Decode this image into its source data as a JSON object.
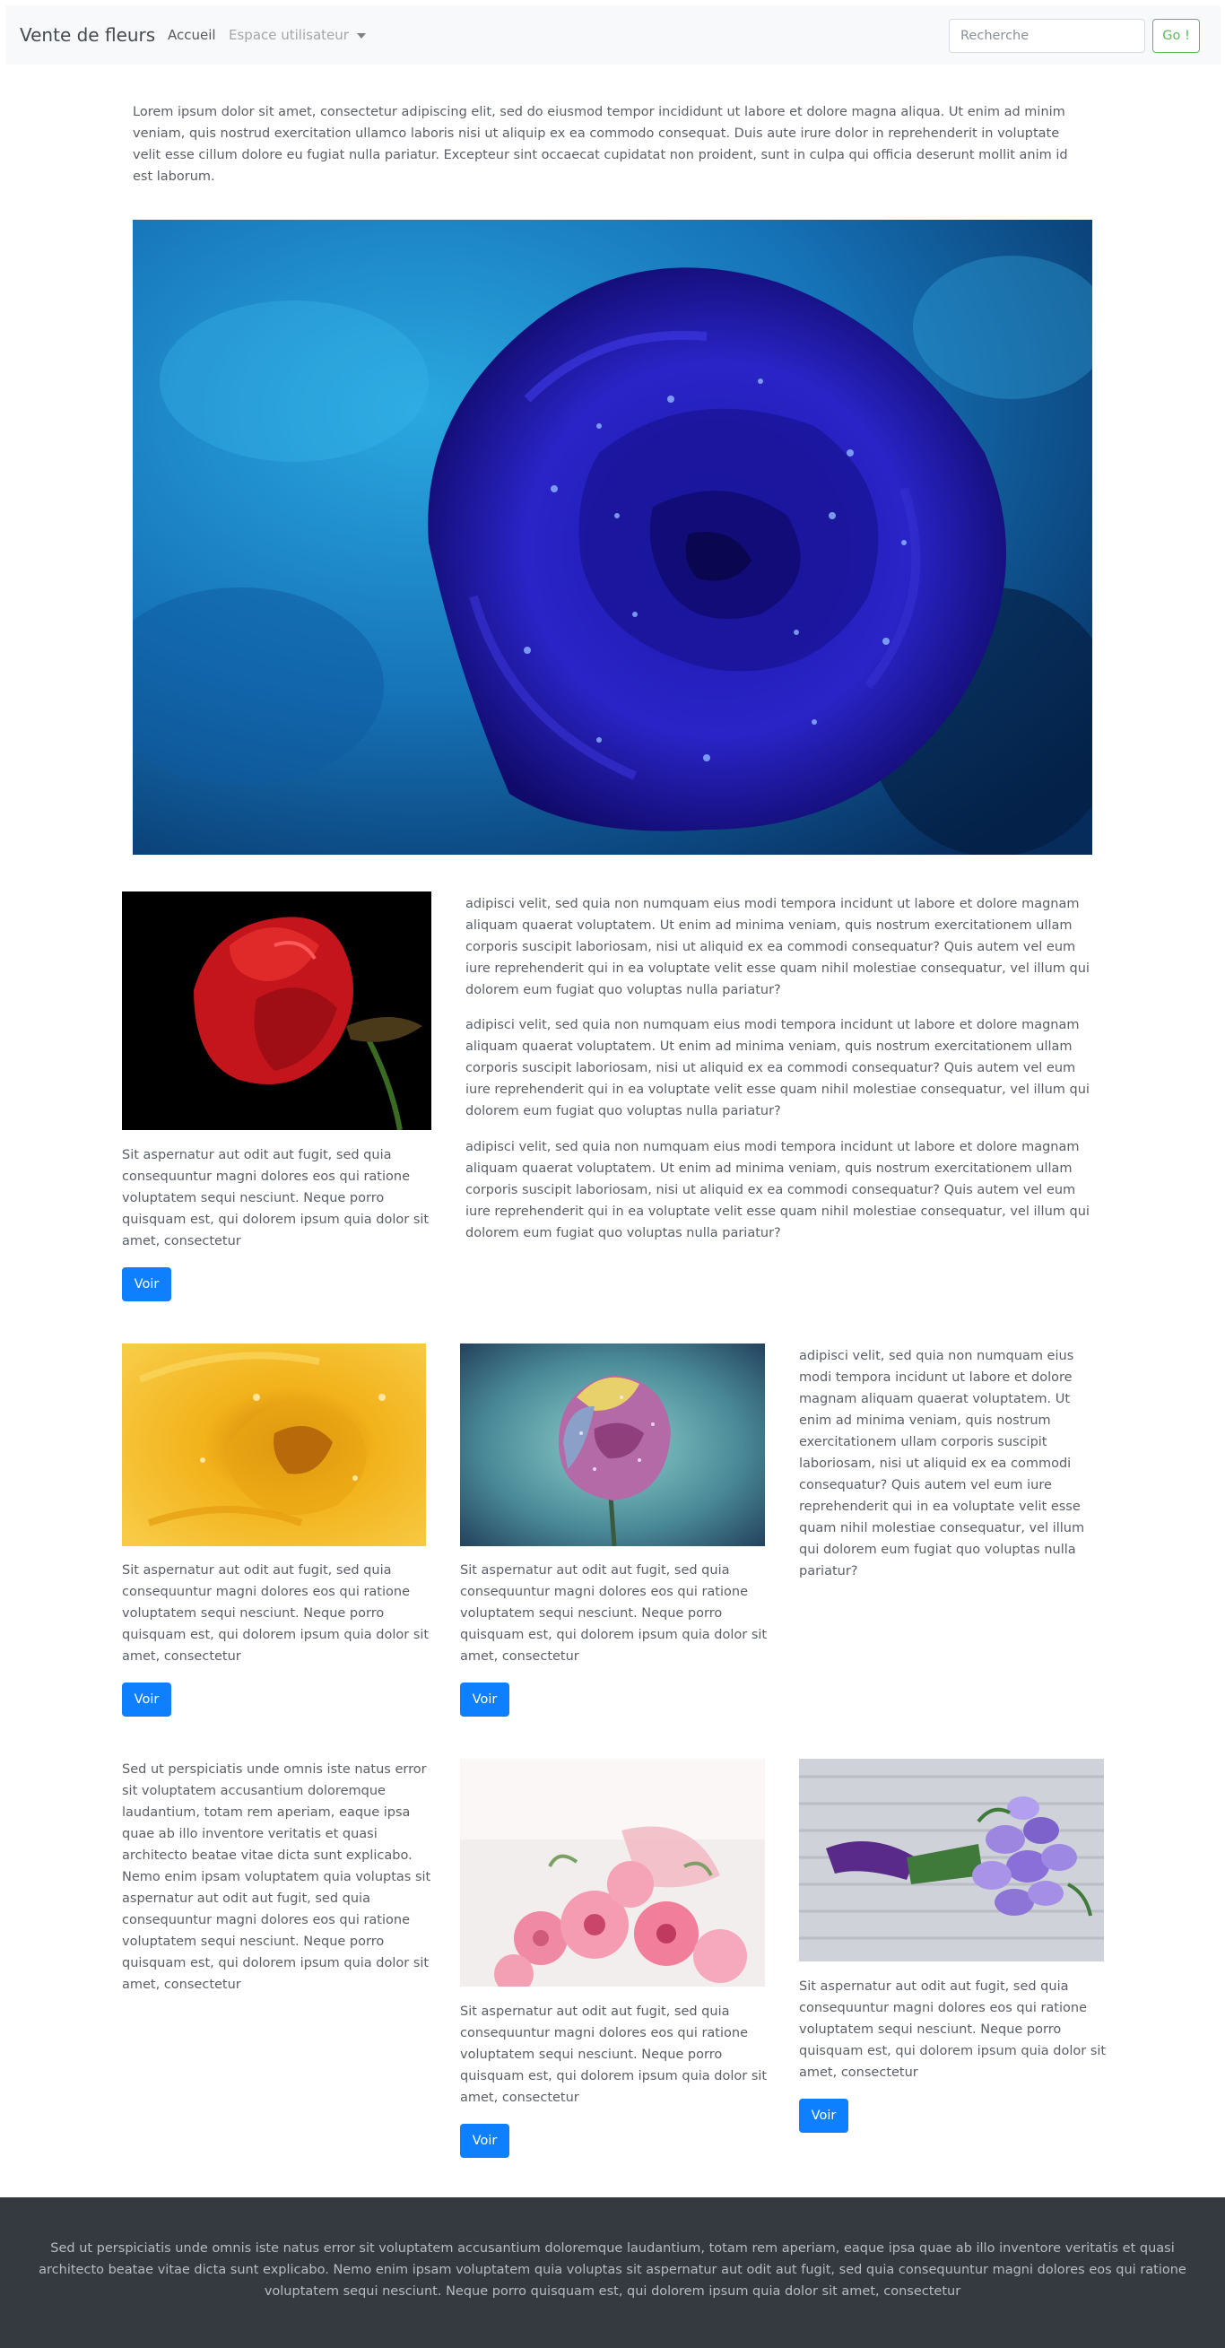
{
  "navbar": {
    "brand": "Vente de fleurs",
    "home_label": "Accueil",
    "user_menu_label": "Espace utilisateur",
    "search_placeholder": "Recherche",
    "search_button": "Go !"
  },
  "intro": "Lorem ipsum dolor sit amet, consectetur adipiscing elit, sed do eiusmod tempor incididunt ut labore et dolore magna aliqua. Ut enim ad minim veniam, quis nostrud exercitation ullamco laboris nisi ut aliquip ex ea commodo consequat. Duis aute irure dolor in reprehenderit in voluptate velit esse cillum dolore eu fugiat nulla pariatur. Excepteur sint occaecat cupidatat non proident, sunt in culpa qui officia deserunt mollit anim id est laborum.",
  "section1": {
    "card": {
      "caption": "Sit aspernatur aut odit aut fugit, sed quia consequuntur magni dolores eos qui ratione voluptatem sequi nesciunt. Neque porro quisquam est, qui dolorem ipsum quia dolor sit amet, consectetur",
      "button": "Voir"
    },
    "paragraphs": [
      "adipisci velit, sed quia non numquam eius modi tempora incidunt ut labore et dolore magnam aliquam quaerat voluptatem. Ut enim ad minima veniam, quis nostrum exercitationem ullam corporis suscipit laboriosam, nisi ut aliquid ex ea commodi consequatur? Quis autem vel eum iure reprehenderit qui in ea voluptate velit esse quam nihil molestiae consequatur, vel illum qui dolorem eum fugiat quo voluptas nulla pariatur?",
      "adipisci velit, sed quia non numquam eius modi tempora incidunt ut labore et dolore magnam aliquam quaerat voluptatem. Ut enim ad minima veniam, quis nostrum exercitationem ullam corporis suscipit laboriosam, nisi ut aliquid ex ea commodi consequatur? Quis autem vel eum iure reprehenderit qui in ea voluptate velit esse quam nihil molestiae consequatur, vel illum qui dolorem eum fugiat quo voluptas nulla pariatur?",
      "adipisci velit, sed quia non numquam eius modi tempora incidunt ut labore et dolore magnam aliquam quaerat voluptatem. Ut enim ad minima veniam, quis nostrum exercitationem ullam corporis suscipit laboriosam, nisi ut aliquid ex ea commodi consequatur? Quis autem vel eum iure reprehenderit qui in ea voluptate velit esse quam nihil molestiae consequatur, vel illum qui dolorem eum fugiat quo voluptas nulla pariatur?"
    ]
  },
  "section2": {
    "card_yellow": {
      "caption": "Sit aspernatur aut odit aut fugit, sed quia consequuntur magni dolores eos qui ratione voluptatem sequi nesciunt. Neque porro quisquam est, qui dolorem ipsum quia dolor sit amet, consectetur",
      "button": "Voir"
    },
    "card_pink": {
      "caption": "Sit aspernatur aut odit aut fugit, sed quia consequuntur magni dolores eos qui ratione voluptatem sequi nesciunt. Neque porro quisquam est, qui dolorem ipsum quia dolor sit amet, consectetur",
      "button": "Voir"
    },
    "side_text": "adipisci velit, sed quia non numquam eius modi tempora incidunt ut labore et dolore magnam aliquam quaerat voluptatem. Ut enim ad minima veniam, quis nostrum exercitationem ullam corporis suscipit laboriosam, nisi ut aliquid ex ea commodi consequatur? Quis autem vel eum iure reprehenderit qui in ea voluptate velit esse quam nihil molestiae consequatur, vel illum qui dolorem eum fugiat quo voluptas nulla pariatur?"
  },
  "section3": {
    "side_text": "Sed ut perspiciatis unde omnis iste natus error sit voluptatem accusantium doloremque laudantium, totam rem aperiam, eaque ipsa quae ab illo inventore veritatis et quasi architecto beatae vitae dicta sunt explicabo. Nemo enim ipsam voluptatem quia voluptas sit aspernatur aut odit aut fugit, sed quia consequuntur magni dolores eos qui ratione voluptatem sequi nesciunt. Neque porro quisquam est, qui dolorem ipsum quia dolor sit amet, consectetur",
    "card_bouquet": {
      "caption": "Sit aspernatur aut odit aut fugit, sed quia consequuntur magni dolores eos qui ratione voluptatem sequi nesciunt. Neque porro quisquam est, qui dolorem ipsum quia dolor sit amet, consectetur",
      "button": "Voir"
    },
    "card_purple": {
      "caption": "Sit aspernatur aut odit aut fugit, sed quia consequuntur magni dolores eos qui ratione voluptatem sequi nesciunt. Neque porro quisquam est, qui dolorem ipsum quia dolor sit amet, consectetur",
      "button": "Voir"
    }
  },
  "footer": "Sed ut perspiciatis unde omnis iste natus error sit voluptatem accusantium doloremque laudantium, totam rem aperiam, eaque ipsa quae ab illo inventore veritatis et quasi architecto beatae vitae dicta sunt explicabo. Nemo enim ipsam voluptatem quia voluptas sit aspernatur aut odit aut fugit, sed quia consequuntur magni dolores eos qui ratione voluptatem sequi nesciunt. Neque porro quisquam est, qui dolorem ipsum quia dolor sit amet, consectetur",
  "colors": {
    "primary_button": "#0d7fff",
    "search_button": "#5cb85c",
    "navbar_bg": "#f8f9fa",
    "footer_bg": "#343a40"
  }
}
